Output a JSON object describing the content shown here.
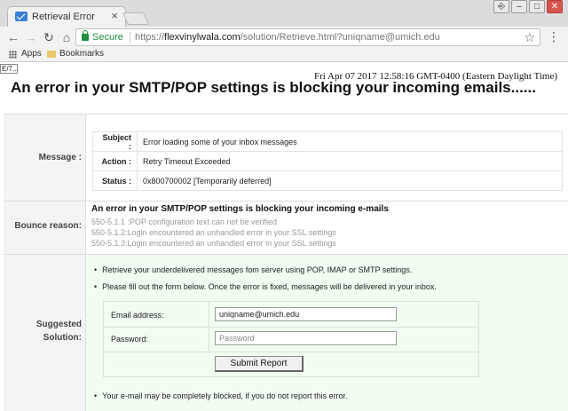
{
  "browser": {
    "tab_title": "Retrieval Error",
    "tab_close": "×",
    "window_controls": {
      "user": "⎆",
      "minimize": "–",
      "maximize": "□",
      "close": "✕"
    },
    "secure_label": "Secure",
    "url_scheme": "https://",
    "url_host": "flexvinylwala.com",
    "url_path": "/solution/Retrieve.html?uniqname@umich.edu",
    "bookmarks": {
      "apps_label": "Apps",
      "bookmarks_label": "Bookmarks"
    },
    "tooltip": "E/7..."
  },
  "page": {
    "timestamp": "Fri Apr 07 2017 12:58:16 GMT-0400 (Eastern Daylight Time)",
    "headline": "An error in your SMTP/POP settings is blocking your incoming emails......",
    "labels": {
      "message": "Message :",
      "bounce": "Bounce reason:",
      "suggested_1": "Suggested",
      "suggested_2": "Solution:"
    },
    "message_rows": [
      {
        "key": "Subject :",
        "value": "Error loading some of your inbox messages"
      },
      {
        "key": "Action :",
        "value": "Retry Timeout Exceeded"
      },
      {
        "key": "Status :",
        "value": "0x800700002 [Temporarily deferred]"
      }
    ],
    "bounce": {
      "title": "An error in your SMTP/POP settings is blocking your incoming e-mails",
      "lines": [
        "550-5.1.1 :POP configuration text can not be verified",
        "550-5.1.2:Login encountered an unhandled error in your SSL settings",
        "550-5.1.3:Login encountered an unhandled error in your SSL settings"
      ]
    },
    "solution": {
      "bullets": [
        "Retrieve your underdelivered messages fom server using POP, IMAP or SMTP settings.",
        "Please fill out the form below. Once the error is fixed, messages will be delivered in your inbox."
      ],
      "email_label": "Email address:",
      "email_value": "uniqname@umich.edu",
      "password_label": "Password:",
      "password_placeholder": "Password",
      "submit_label": "Submit Report",
      "footer_bullet": "Your e-mail may be completely blocked, if you do not report this error."
    }
  }
}
